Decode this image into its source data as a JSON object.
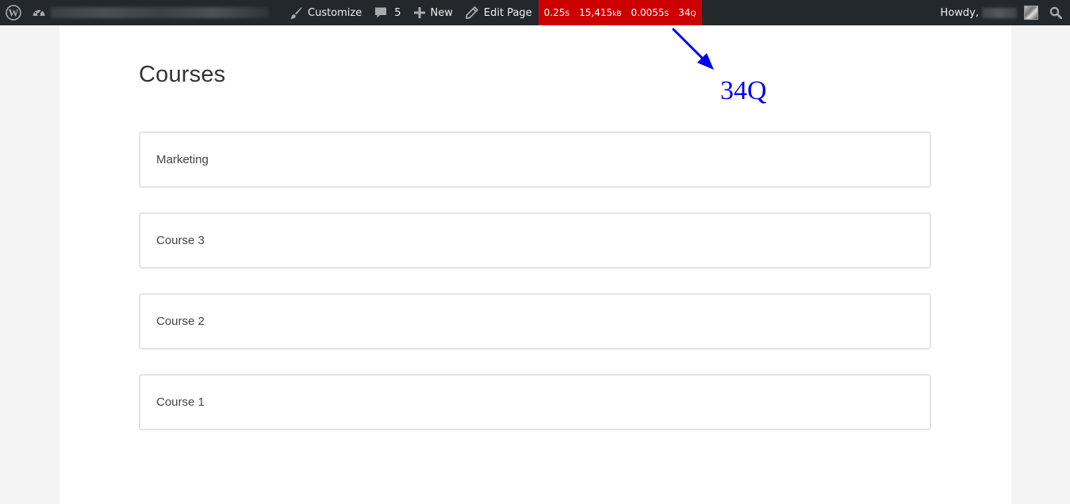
{
  "adminbar": {
    "customize_label": "Customize",
    "comments_count": "5",
    "new_label": "New",
    "edit_page_label": "Edit Page",
    "query_monitor": {
      "time": "0.25",
      "time_unit": "S",
      "memory": "15,415",
      "memory_unit": "kB",
      "db_time": "0.0055",
      "db_time_unit": "S",
      "queries": "34",
      "queries_unit": "Q"
    },
    "howdy_label": "Howdy,"
  },
  "page": {
    "title": "Courses",
    "courses": [
      {
        "name": "Marketing"
      },
      {
        "name": "Course 3"
      },
      {
        "name": "Course 2"
      },
      {
        "name": "Course 1"
      }
    ]
  },
  "annotation": {
    "text": "34Q",
    "color": "#0000ee"
  },
  "colors": {
    "adminbar_bg": "#23282d",
    "query_monitor_bg": "#cc0000"
  }
}
